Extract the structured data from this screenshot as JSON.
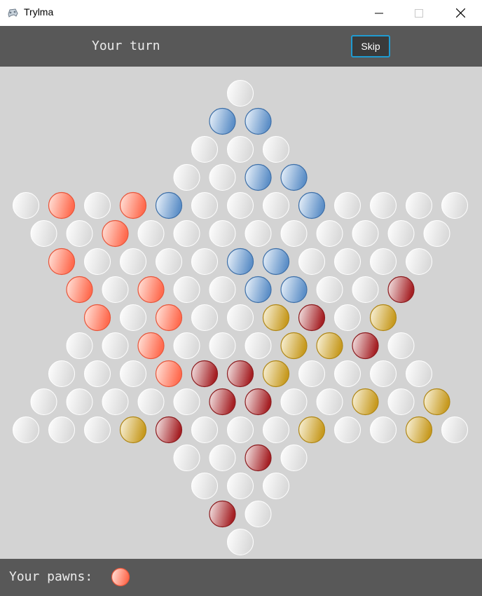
{
  "window": {
    "title": "Trylma",
    "icon": "game-controller-icon"
  },
  "header": {
    "turn_text": "Your turn",
    "skip_label": "Skip"
  },
  "footer": {
    "pawns_label": "Your pawns:",
    "pawn_color": "red-light"
  },
  "colors": {
    "empty": {
      "light": "#ffffff",
      "dark": "#d9d9d9",
      "stroke": "#ffffff"
    },
    "blue": {
      "light": "#f0f6fc",
      "dark": "#5d8fc7",
      "stroke": "#3d6fa8"
    },
    "red-light": {
      "light": "#ffe8e0",
      "dark": "#ff6b4f",
      "stroke": "#e8553a"
    },
    "red-dark": {
      "light": "#f6ecec",
      "dark": "#a52024",
      "stroke": "#8c1c1f"
    },
    "gold": {
      "light": "#fbf6e2",
      "dark": "#c79a20",
      "stroke": "#b08716"
    }
  },
  "board": {
    "rows": [
      [
        "empty"
      ],
      [
        "blue",
        "blue"
      ],
      [
        "empty",
        "empty",
        "empty"
      ],
      [
        "empty",
        "empty",
        "blue",
        "blue"
      ],
      [
        "empty",
        "red-light",
        "empty",
        "red-light",
        "blue",
        "empty",
        "empty",
        "empty",
        "blue",
        "empty",
        "empty",
        "empty",
        "empty"
      ],
      [
        "empty",
        "empty",
        "red-light",
        "empty",
        "empty",
        "empty",
        "empty",
        "empty",
        "empty",
        "empty",
        "empty",
        "empty"
      ],
      [
        "red-light",
        "empty",
        "empty",
        "empty",
        "empty",
        "blue",
        "blue",
        "empty",
        "empty",
        "empty",
        "empty"
      ],
      [
        "red-light",
        "empty",
        "red-light",
        "empty",
        "empty",
        "blue",
        "blue",
        "empty",
        "empty",
        "red-dark"
      ],
      [
        "red-light",
        "empty",
        "red-light",
        "empty",
        "empty",
        "gold",
        "red-dark",
        "empty",
        "gold"
      ],
      [
        "empty",
        "empty",
        "red-light",
        "empty",
        "empty",
        "empty",
        "gold",
        "gold",
        "red-dark",
        "empty"
      ],
      [
        "empty",
        "empty",
        "empty",
        "red-light",
        "red-dark",
        "red-dark",
        "gold",
        "empty",
        "empty",
        "empty",
        "empty"
      ],
      [
        "empty",
        "empty",
        "empty",
        "empty",
        "empty",
        "red-dark",
        "red-dark",
        "empty",
        "empty",
        "gold",
        "empty",
        "gold"
      ],
      [
        "empty",
        "empty",
        "empty",
        "gold",
        "red-dark",
        "empty",
        "empty",
        "empty",
        "gold",
        "empty",
        "empty",
        "gold",
        "empty"
      ],
      [
        "empty",
        "empty",
        "red-dark",
        "empty"
      ],
      [
        "empty",
        "empty",
        "empty"
      ],
      [
        "red-dark",
        "empty"
      ],
      [
        "empty"
      ]
    ]
  }
}
